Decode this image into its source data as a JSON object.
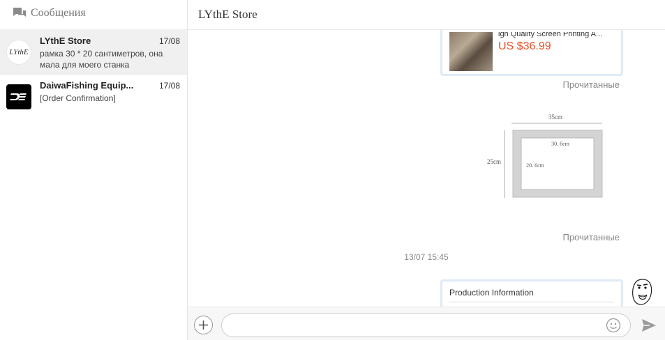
{
  "sidebar": {
    "title": "Сообщения",
    "title_icon": "chat-bubbles-icon",
    "conversations": [
      {
        "name": "LYthE Store",
        "date": "17/08",
        "preview": "рамка 30 * 20 сантиметров, она мала для моего станка",
        "avatar_text": "LYthE",
        "active": true
      },
      {
        "name": "DaiwaFishing Equip...",
        "date": "17/08",
        "preview": "[Order Confirmation]",
        "avatar_text": "D",
        "active": false
      }
    ]
  },
  "main": {
    "title": "LYthE Store",
    "messages": {
      "product_card": {
        "name": "igh Quality Screen Printing A...",
        "price": "US $36.99"
      },
      "read_status_1": "Прочитанные",
      "frame_image": {
        "top_label": "35cm",
        "side_label": "25cm",
        "inner_width_label": "30. 6cm",
        "inner_height_label": "20. 6cm"
      },
      "read_status_2": "Прочитанные",
      "time_separator": "13/07 15:45",
      "info_card_title": "Production Information"
    },
    "composer": {
      "input_value": "",
      "input_placeholder": "",
      "add_icon": "plus-icon",
      "emoji_icon": "smiley-icon",
      "send_icon": "send-icon"
    }
  },
  "colors": {
    "price": "#e8502a",
    "card_border": "#dfeaf7",
    "active_item_bg": "#f0f0f0"
  }
}
